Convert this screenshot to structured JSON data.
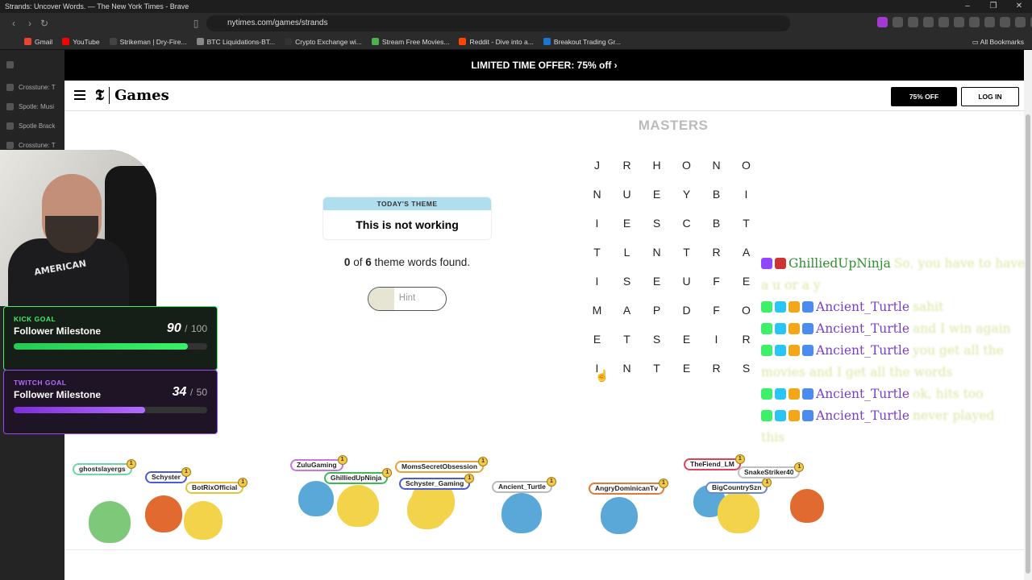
{
  "window": {
    "title": "Strands: Uncover Words. — The New York Times - Brave",
    "controls": [
      "–",
      "❐",
      "✕"
    ]
  },
  "browser": {
    "url": "nytimes.com/games/strands",
    "bookmarks": [
      {
        "label": "Gmail",
        "color": "#ea4335"
      },
      {
        "label": "YouTube",
        "color": "#ff0000"
      },
      {
        "label": "Strikeman | Dry-Fire...",
        "color": "#444444"
      },
      {
        "label": "BTC Liquidations-BT...",
        "color": "#888888"
      },
      {
        "label": "Crypto Exchange wi...",
        "color": "#333333"
      },
      {
        "label": "Stream Free Movies...",
        "color": "#4caf50"
      },
      {
        "label": "Reddit - Dive into a...",
        "color": "#ff4500"
      },
      {
        "label": "Breakout Trading Gr...",
        "color": "#1976d2"
      }
    ],
    "all_bookmarks": "All Bookmarks"
  },
  "sidebar": {
    "items": [
      "Crosstune: T",
      "Spotle: Musi",
      "Spotle Brack",
      "Crosstune: T"
    ]
  },
  "page": {
    "promo": "LIMITED TIME OFFER: 75% off ›",
    "logo": "Games",
    "logo_mark": "𝕿",
    "offer_button": "75% OFF",
    "login_button": "LOG IN"
  },
  "game": {
    "board_title": "MASTERS",
    "theme_header": "TODAY'S THEME",
    "theme": "This is not working",
    "found_count": "0",
    "found_of": "of",
    "found_total": "6",
    "found_suffix": "theme words found.",
    "hint_label": "Hint",
    "hint_progress": 0.33,
    "grid": [
      [
        "J",
        "R",
        "H",
        "O",
        "N",
        "O"
      ],
      [
        "N",
        "U",
        "E",
        "Y",
        "B",
        "I"
      ],
      [
        "I",
        "E",
        "S",
        "C",
        "B",
        "T"
      ],
      [
        "T",
        "L",
        "N",
        "T",
        "R",
        "A"
      ],
      [
        "I",
        "S",
        "E",
        "U",
        "F",
        "E"
      ],
      [
        "M",
        "A",
        "P",
        "D",
        "F",
        "O"
      ],
      [
        "E",
        "T",
        "S",
        "E",
        "I",
        "R"
      ],
      [
        "I",
        "N",
        "T",
        "E",
        "R",
        "S"
      ]
    ]
  },
  "overlay": {
    "webcam_shirt": "AMERICAN",
    "kick_goal": {
      "label": "KICK GOAL",
      "name": "Follower Milestone",
      "current": 90,
      "target": 100,
      "separator": "/"
    },
    "twitch_goal": {
      "label": "TWITCH GOAL",
      "name": "Follower Milestone",
      "current": 34,
      "target": 50,
      "separator": "/"
    },
    "chat": [
      {
        "user": "GhilliedUpNinja",
        "text": "So, you have to have",
        "wrap": "a u or a y",
        "color": "#2e8f2e",
        "badges": [
          "twitch",
          "mod"
        ]
      },
      {
        "user": "Ancient_Turtle",
        "text": "sahit",
        "color": "#7a3fc7",
        "badges": [
          "kick",
          "sub",
          "crown",
          "sword"
        ]
      },
      {
        "user": "Ancient_Turtle",
        "text": "and I win again",
        "color": "#7a3fc7",
        "badges": [
          "kick",
          "sub",
          "crown",
          "sword"
        ]
      },
      {
        "user": "Ancient_Turtle",
        "text": "you get all the",
        "wrap": "movies and I get all the words",
        "color": "#7a3fc7",
        "badges": [
          "kick",
          "sub",
          "crown",
          "sword"
        ]
      },
      {
        "user": "Ancient_Turtle",
        "text": "ok, hits too",
        "color": "#7a3fc7",
        "badges": [
          "kick",
          "sub",
          "crown",
          "sword"
        ]
      },
      {
        "user": "Ancient_Turtle",
        "text": "never played",
        "wrap": "this",
        "color": "#7a3fc7",
        "badges": [
          "kick",
          "sub",
          "crown",
          "sword"
        ]
      }
    ],
    "viewers": [
      {
        "name": "ghostslayergs",
        "border": "#6ed6a8",
        "coin": "1"
      },
      {
        "name": "Schyster",
        "border": "#4a5bd6",
        "coin": "1"
      },
      {
        "name": "BotRixOfficial",
        "border": "#e8c23a",
        "coin": "1"
      },
      {
        "name": "ZuluGaming",
        "border": "#c678e0",
        "coin": "1"
      },
      {
        "name": "GhilliedUpNinja",
        "border": "#3cba54",
        "coin": "1"
      },
      {
        "name": "Schyster_Gaming",
        "border": "#4a5bd6",
        "coin": "1"
      },
      {
        "name": "MomsSecretObsession",
        "border": "#e8a23a",
        "coin": "1"
      },
      {
        "name": "Ancient_Turtle",
        "border": "#b9b9b9",
        "coin": "1"
      },
      {
        "name": "AngryDominicanTv",
        "border": "#e07a3a",
        "coin": "1"
      },
      {
        "name": "TheFiend_LM",
        "border": "#e0405a",
        "coin": "1"
      },
      {
        "name": "BigCountrySzn",
        "border": "#6a8ad6",
        "coin": "1"
      },
      {
        "name": "SnakeStriker40",
        "border": "#c0c0c0",
        "coin": "1"
      }
    ]
  }
}
